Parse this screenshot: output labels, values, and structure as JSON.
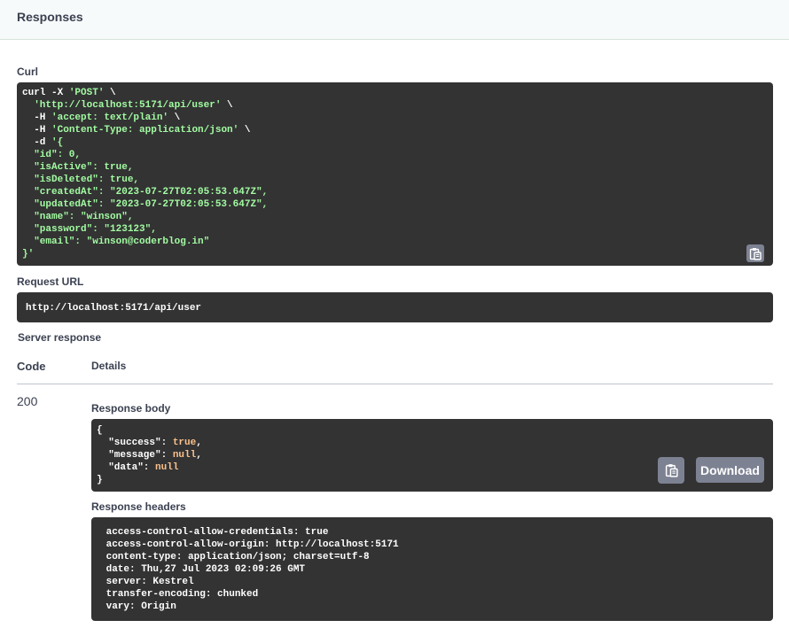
{
  "header": {
    "title": "Responses"
  },
  "curl": {
    "label": "Curl",
    "lines": [
      [
        {
          "t": "curl -X "
        },
        {
          "t": "'POST'",
          "s": "str"
        },
        {
          "t": " \\"
        }
      ],
      [
        {
          "t": "  "
        },
        {
          "t": "'http://localhost:5171/api/user'",
          "s": "str"
        },
        {
          "t": " \\"
        }
      ],
      [
        {
          "t": "  -H "
        },
        {
          "t": "'accept: text/plain'",
          "s": "str"
        },
        {
          "t": " \\"
        }
      ],
      [
        {
          "t": "  -H "
        },
        {
          "t": "'Content-Type: application/json'",
          "s": "str"
        },
        {
          "t": " \\"
        }
      ],
      [
        {
          "t": "  -d "
        },
        {
          "t": "'{",
          "s": "str"
        }
      ],
      [
        {
          "t": "  \"id\": 0,",
          "s": "str"
        }
      ],
      [
        {
          "t": "  \"isActive\": true,",
          "s": "str"
        }
      ],
      [
        {
          "t": "  \"isDeleted\": true,",
          "s": "str"
        }
      ],
      [
        {
          "t": "  \"createdAt\": \"2023-07-27T02:05:53.647Z\",",
          "s": "str"
        }
      ],
      [
        {
          "t": "  \"updatedAt\": \"2023-07-27T02:05:53.647Z\",",
          "s": "str"
        }
      ],
      [
        {
          "t": "  \"name\": \"winson\",",
          "s": "str"
        }
      ],
      [
        {
          "t": "  \"password\": \"123123\",",
          "s": "str"
        }
      ],
      [
        {
          "t": "  \"email\": \"winson@coderblog.in\"",
          "s": "str"
        }
      ],
      [
        {
          "t": "}'",
          "s": "str"
        }
      ]
    ]
  },
  "request_url": {
    "label": "Request URL",
    "value": "http://localhost:5171/api/user"
  },
  "server_response": {
    "label": "Server response",
    "col_code": "Code",
    "col_details": "Details",
    "code": "200",
    "body_label": "Response body",
    "body_lines": [
      [
        {
          "t": "{"
        }
      ],
      [
        {
          "t": "  \"success\": "
        },
        {
          "t": "true",
          "s": "lit"
        },
        {
          "t": ","
        }
      ],
      [
        {
          "t": "  \"message\": "
        },
        {
          "t": "null",
          "s": "lit"
        },
        {
          "t": ","
        }
      ],
      [
        {
          "t": "  \"data\": "
        },
        {
          "t": "null",
          "s": "lit"
        }
      ],
      [
        {
          "t": "}"
        }
      ]
    ],
    "download_label": "Download",
    "headers_label": "Response headers",
    "headers_text": " access-control-allow-credentials: true \n access-control-allow-origin: http://localhost:5171 \n content-type: application/json; charset=utf-8 \n date: Thu,27 Jul 2023 02:09:26 GMT \n server: Kestrel \n transfer-encoding: chunked \n vary: Origin "
  },
  "icons": {
    "copy": "clipboard-copy-icon"
  },
  "colors": {
    "code_bg": "#333333",
    "string": "#a2fca2",
    "literal": "#fcc28c",
    "button": "#7d8293"
  }
}
